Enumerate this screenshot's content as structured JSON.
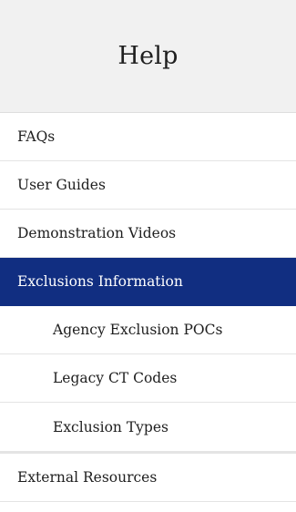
{
  "header": {
    "title": "Help"
  },
  "nav": {
    "items": [
      {
        "label": "FAQs"
      },
      {
        "label": "User Guides"
      },
      {
        "label": "Demonstration Videos"
      },
      {
        "label": "Exclusions Information",
        "active": true
      },
      {
        "label": "Agency Exclusion POCs"
      },
      {
        "label": "Legacy CT Codes"
      },
      {
        "label": "Exclusion Types"
      },
      {
        "label": "External Resources"
      }
    ]
  },
  "colors": {
    "active_background": "#112e81",
    "header_background": "#f1f1f1",
    "divider": "#e4e4e4"
  }
}
